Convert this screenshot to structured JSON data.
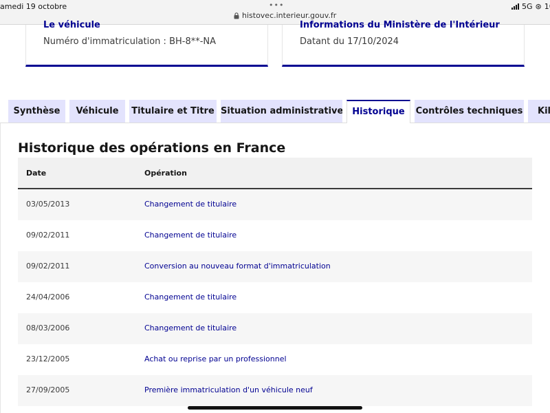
{
  "status_bar": {
    "date": "amedi 19 octobre",
    "url": "histovec.interieur.gouv.fr",
    "network": "5G",
    "battery_partial": "10"
  },
  "cards": [
    {
      "title": "Le véhicule",
      "text": "Numéro d'immatriculation : BH-8**-NA"
    },
    {
      "title": "Informations du Ministère de l'Intérieur",
      "text": "Datant du 17/10/2024"
    }
  ],
  "tabs": [
    {
      "label": "Synthèse",
      "active": false
    },
    {
      "label": "Véhicule",
      "active": false
    },
    {
      "label": "Titulaire et Titre",
      "active": false
    },
    {
      "label": "Situation administrative",
      "active": false
    },
    {
      "label": "Historique",
      "active": true
    },
    {
      "label": "Contrôles techniques",
      "active": false
    },
    {
      "label": "Kilo",
      "active": false
    }
  ],
  "section": {
    "title": "Historique des opérations en France"
  },
  "table": {
    "headers": {
      "date": "Date",
      "operation": "Opération"
    },
    "rows": [
      {
        "date": "03/05/2013",
        "operation": "Changement de titulaire"
      },
      {
        "date": "09/02/2011",
        "operation": "Changement de titulaire"
      },
      {
        "date": "09/02/2011",
        "operation": "Conversion au nouveau format d'immatriculation"
      },
      {
        "date": "24/04/2006",
        "operation": "Changement de titulaire"
      },
      {
        "date": "08/03/2006",
        "operation": "Changement de titulaire"
      },
      {
        "date": "23/12/2005",
        "operation": "Achat ou reprise par un professionnel"
      },
      {
        "date": "27/09/2005",
        "operation": "Première immatriculation d'un véhicule neuf"
      }
    ]
  },
  "colors": {
    "accent": "#000091",
    "tab_bg": "#e3e3fd",
    "row_alt": "#f6f6f6"
  }
}
